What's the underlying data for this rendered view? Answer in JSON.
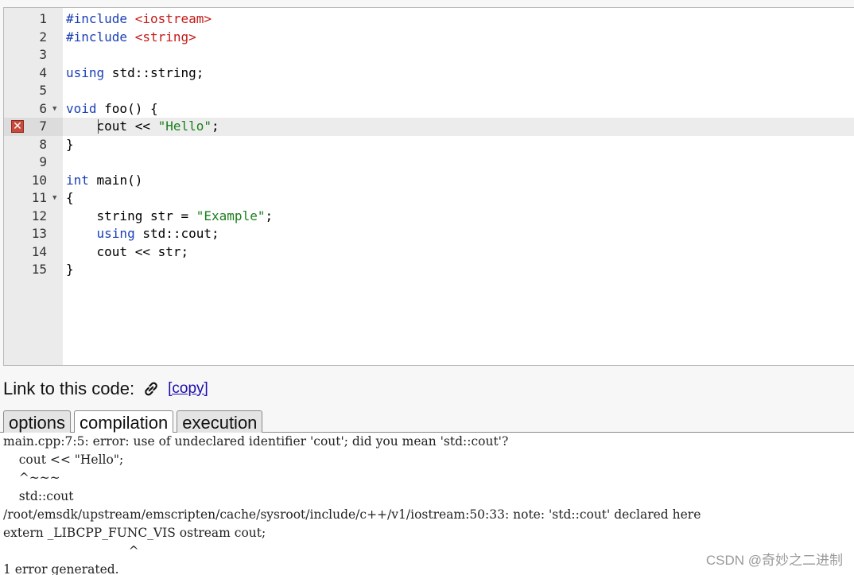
{
  "editor": {
    "lines": [
      {
        "num": "1",
        "tokens": [
          {
            "t": "#include ",
            "c": "kw"
          },
          {
            "t": "<iostream>",
            "c": "inc"
          }
        ]
      },
      {
        "num": "2",
        "tokens": [
          {
            "t": "#include ",
            "c": "kw"
          },
          {
            "t": "<string>",
            "c": "inc"
          }
        ]
      },
      {
        "num": "3",
        "tokens": []
      },
      {
        "num": "4",
        "tokens": [
          {
            "t": "using",
            "c": "kw"
          },
          {
            "t": " std::string;",
            "c": ""
          }
        ]
      },
      {
        "num": "5",
        "tokens": []
      },
      {
        "num": "6",
        "fold": true,
        "tokens": [
          {
            "t": "void",
            "c": "kw"
          },
          {
            "t": " foo() {",
            "c": ""
          }
        ]
      },
      {
        "num": "7",
        "error": true,
        "active": true,
        "tokens": [
          {
            "t": "    cout << ",
            "c": ""
          },
          {
            "t": "\"Hello\"",
            "c": "str"
          },
          {
            "t": ";",
            "c": ""
          }
        ]
      },
      {
        "num": "8",
        "tokens": [
          {
            "t": "}",
            "c": ""
          }
        ]
      },
      {
        "num": "9",
        "tokens": []
      },
      {
        "num": "10",
        "tokens": [
          {
            "t": "int",
            "c": "kw"
          },
          {
            "t": " main()",
            "c": ""
          }
        ]
      },
      {
        "num": "11",
        "fold": true,
        "tokens": [
          {
            "t": "{",
            "c": ""
          }
        ]
      },
      {
        "num": "12",
        "tokens": [
          {
            "t": "    string str = ",
            "c": ""
          },
          {
            "t": "\"Example\"",
            "c": "str"
          },
          {
            "t": ";",
            "c": ""
          }
        ]
      },
      {
        "num": "13",
        "tokens": [
          {
            "t": "    ",
            "c": ""
          },
          {
            "t": "using",
            "c": "kw"
          },
          {
            "t": " std::cout;",
            "c": ""
          }
        ]
      },
      {
        "num": "14",
        "tokens": [
          {
            "t": "    cout << str;",
            "c": ""
          }
        ]
      },
      {
        "num": "15",
        "tokens": [
          {
            "t": "}",
            "c": ""
          }
        ]
      }
    ]
  },
  "link": {
    "label": "Link to this code:",
    "copy_label": "[copy]",
    "icon": "chain-link-icon"
  },
  "tabs": {
    "options": "options",
    "compilation": "compilation",
    "execution": "execution",
    "selected": "compilation"
  },
  "output": {
    "lines": [
      "main.cpp:7:5: error: use of undeclared identifier 'cout'; did you mean 'std::cout'?",
      "    cout << \"Hello\";",
      "    ^~~~",
      "    std::cout",
      "/root/emsdk/upstream/emscripten/cache/sysroot/include/c++/v1/iostream:50:33: note: 'std::cout' declared here",
      "extern _LIBCPP_FUNC_VIS ostream cout;",
      "                                ^",
      "1 error generated."
    ]
  },
  "watermark": "CSDN @奇妙之二进制",
  "colors": {
    "keyword": "#1a3fb5",
    "string": "#1a7f1a",
    "include": "#c41a16",
    "error_icon": "#c84a3c"
  }
}
